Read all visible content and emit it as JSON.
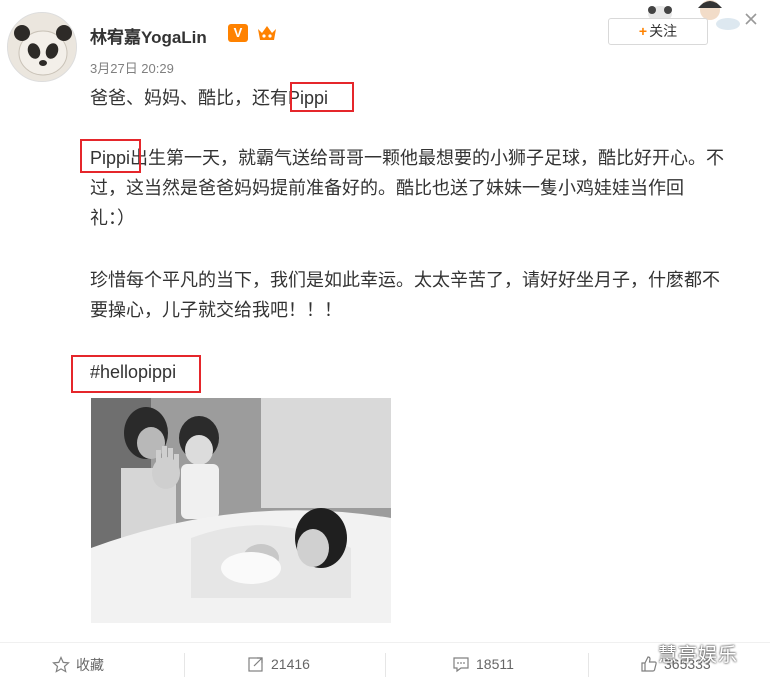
{
  "header": {
    "username": "林宥嘉YogaLin",
    "verified_badge": "V",
    "timestamp": "3月27日 20:29",
    "follow_label": "+关注",
    "follow_plus": "+",
    "follow_text": "关注"
  },
  "post": {
    "line1": "爸爸、妈妈、酷比，还有Pippi",
    "line2": "Pippi出生第一天，就霸气送给哥哥一颗他最想要的小狮子足球，酷比好开心。不",
    "line3": "过，这当然是爸爸妈妈提前准备好的。酷比也送了妹妹一隻小鸡娃娃当作回",
    "line4": "礼：）",
    "line5": "珍惜每个平凡的当下，我们是如此幸运。太太辛苦了，请好好坐月子，什麽都不",
    "line6": "要操心，儿子就交给我吧！！！",
    "line7": "#hellopippi"
  },
  "actions": {
    "favorite": "收藏",
    "repost_count": "21416",
    "comment_count": "18511",
    "like_count": "365333"
  },
  "watermark": "慧亭娱乐",
  "icons": {
    "favorite": "star-icon",
    "repost": "share-icon",
    "comment": "comment-icon",
    "like": "thumbs-up-icon",
    "close": "close-icon"
  },
  "colors": {
    "brand_orange": "#ff8200",
    "highlight_red": "#e5262b",
    "text": "#333333",
    "muted": "#808080"
  }
}
